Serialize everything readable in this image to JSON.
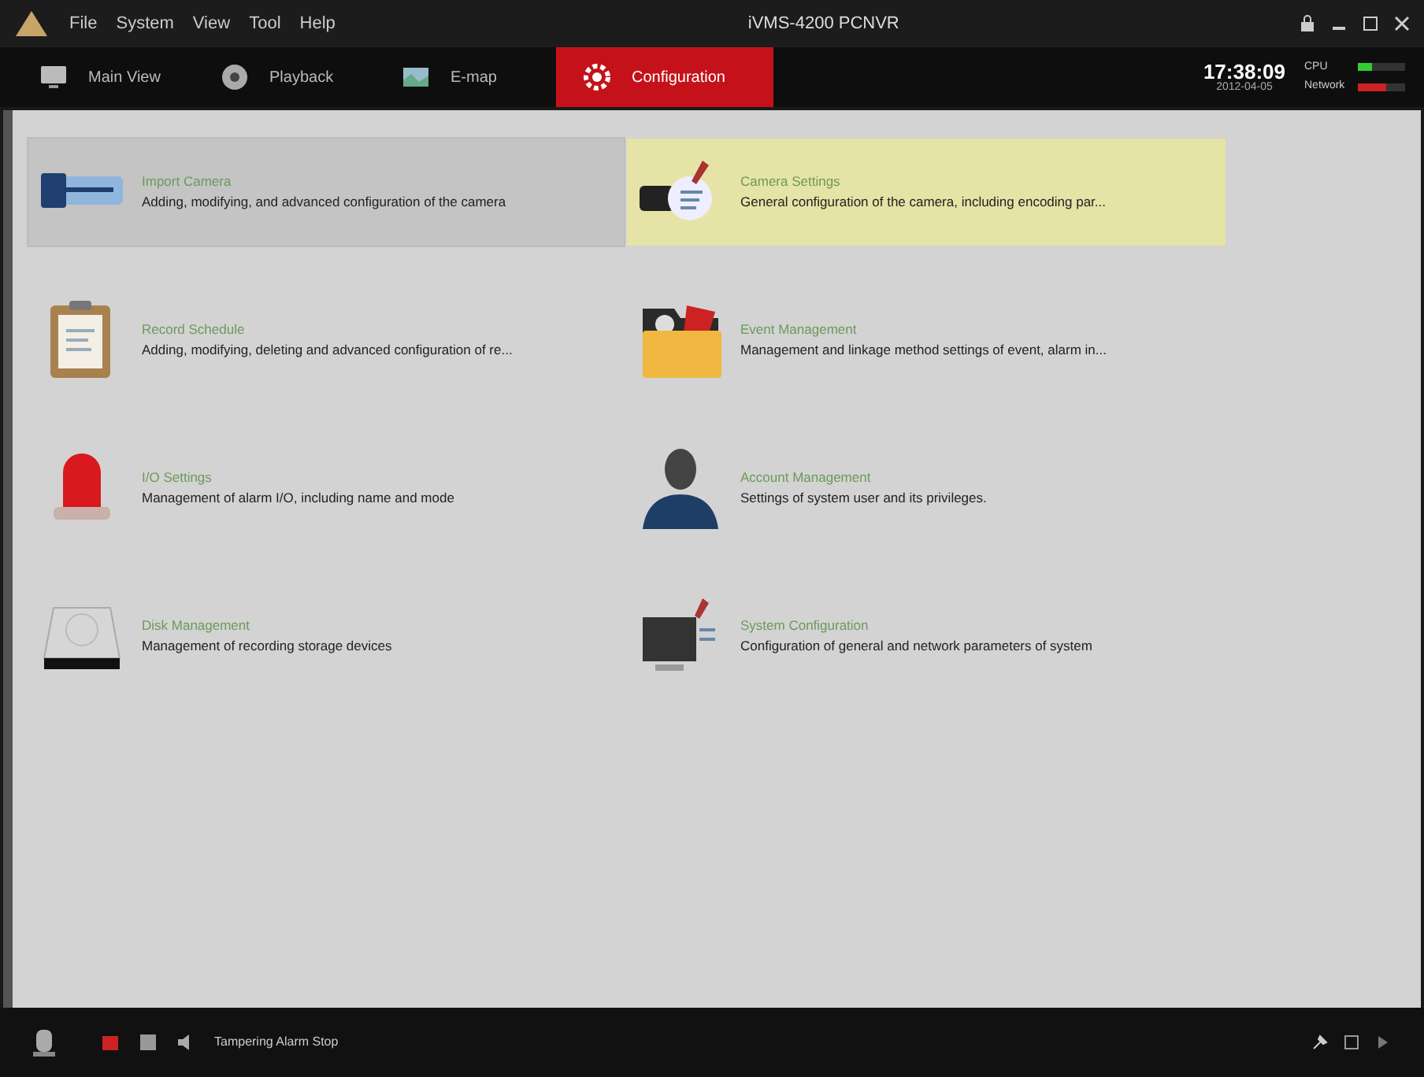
{
  "window": {
    "title": "iVMS-4200 PCNVR",
    "menu": [
      "File",
      "System",
      "View",
      "Tool",
      "Help"
    ]
  },
  "tabs": [
    {
      "label": "Main View",
      "selected": false
    },
    {
      "label": "Playback",
      "selected": false
    },
    {
      "label": "E-map",
      "selected": false
    },
    {
      "label": "Configuration",
      "selected": true
    }
  ],
  "clock": {
    "time": "17:38:09",
    "date": "2012-04-05"
  },
  "meters": [
    {
      "label": "CPU",
      "level": 0.3
    },
    {
      "label": "Network",
      "level": 0.6
    }
  ],
  "modules": [
    {
      "title": "Import Camera",
      "description": "Adding, modifying, and advanced configuration of the camera",
      "hovered": true,
      "selected": false
    },
    {
      "title": "Camera Settings",
      "description": "General configuration of the camera, including encoding par...",
      "hovered": false,
      "selected": true
    },
    {
      "title": "Record Schedule",
      "description": "Adding, modifying, deleting and advanced configuration of re...",
      "hovered": false,
      "selected": false
    },
    {
      "title": "Event Management",
      "description": "Management and linkage method settings of event, alarm in...",
      "hovered": false,
      "selected": false
    },
    {
      "title": "I/O Settings",
      "description": "Management of alarm I/O, including name and mode",
      "hovered": false,
      "selected": false
    },
    {
      "title": "Account Management",
      "description": "Settings of system user and its privileges.",
      "hovered": false,
      "selected": false
    },
    {
      "title": "Disk Management",
      "description": "Management of recording storage devices",
      "hovered": false,
      "selected": false
    },
    {
      "title": "System Configuration",
      "description": "Configuration of general and network parameters of system",
      "hovered": false,
      "selected": false
    }
  ],
  "status_bar": {
    "message": "Tampering Alarm Stop"
  }
}
